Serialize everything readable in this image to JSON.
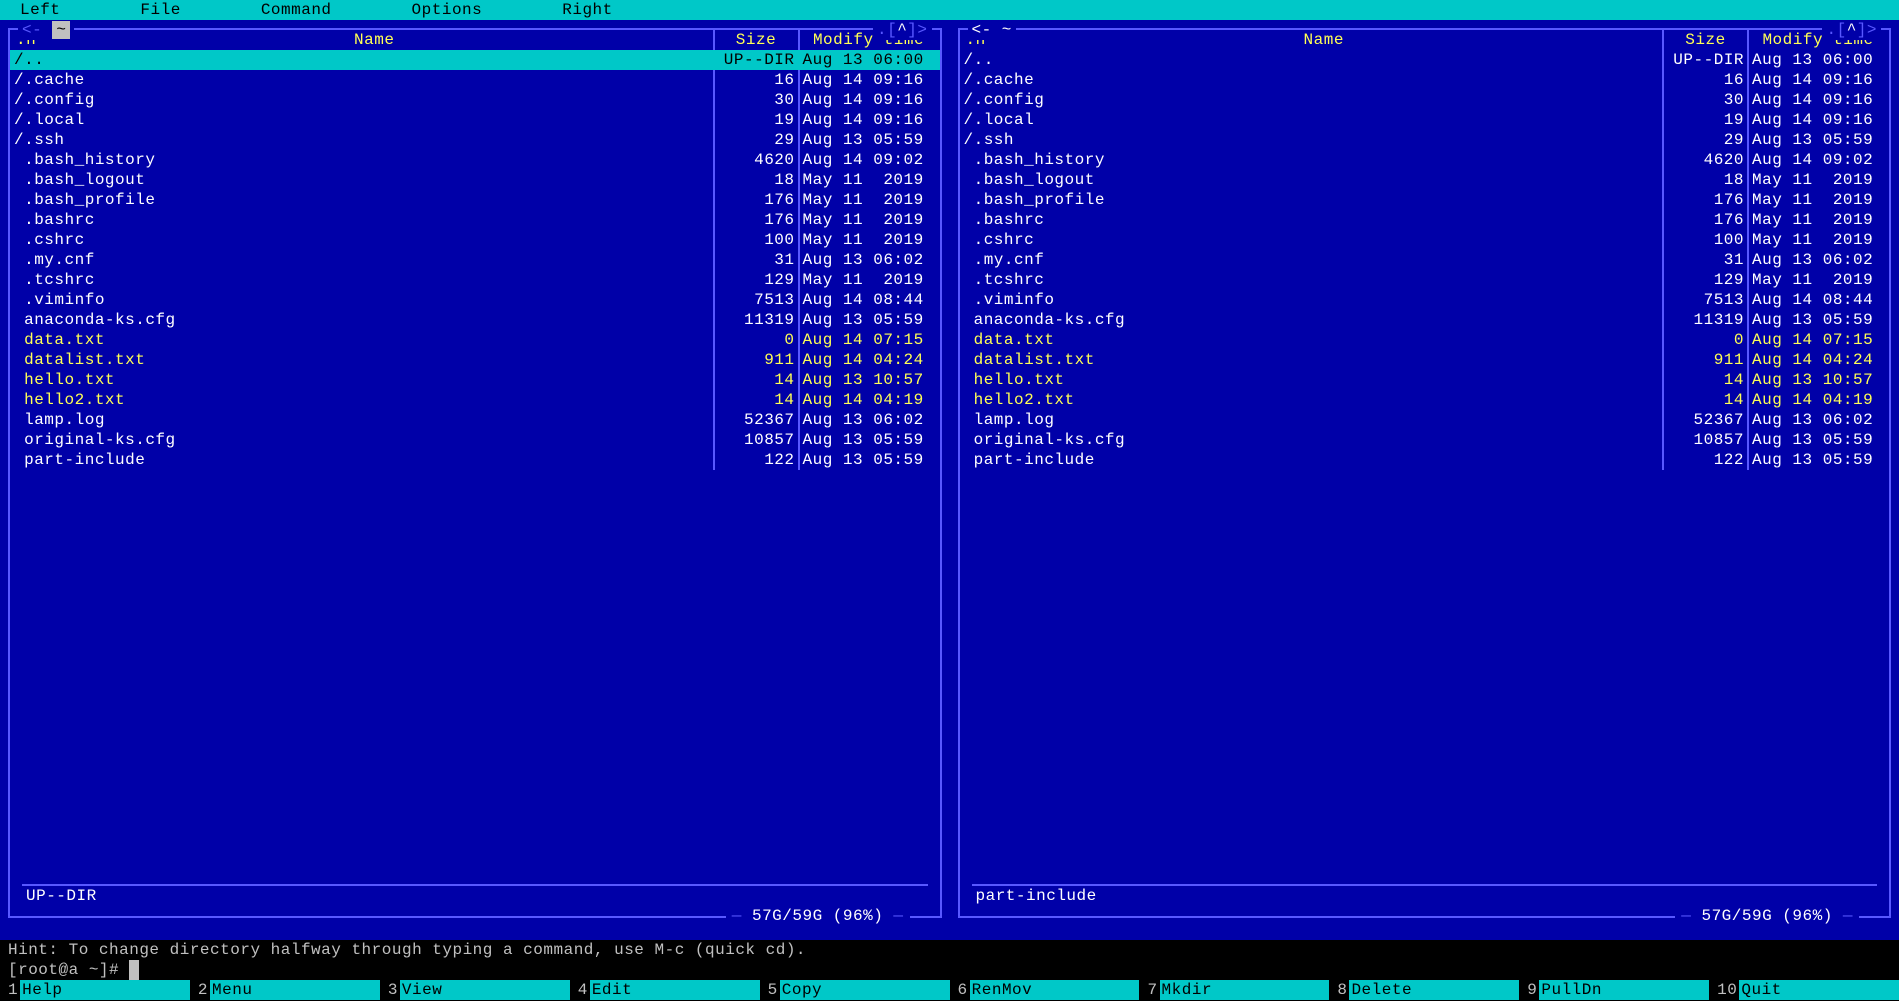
{
  "menubar": {
    "left": "Left",
    "file": "File",
    "command": "Command",
    "options": "Options",
    "right": "Right"
  },
  "panel_indicator": ".[^]>",
  "left_panel_prefix": "<- ",
  "right_panel_prefix": "<- ~ ",
  "cwd_symbol": "~",
  "headers": {
    "sort": ".n",
    "name": "Name",
    "size": "Size",
    "mtime": "Modify time"
  },
  "left_panel": {
    "selected_index": 0,
    "status": "UP--DIR",
    "disk": "57G/59G (96%)",
    "rows": [
      {
        "name": "/..",
        "size": "UP--DIR",
        "mtime": "Aug 13 06:00",
        "yellow": false
      },
      {
        "name": "/.cache",
        "size": "16",
        "mtime": "Aug 14 09:16",
        "yellow": false
      },
      {
        "name": "/.config",
        "size": "30",
        "mtime": "Aug 14 09:16",
        "yellow": false
      },
      {
        "name": "/.local",
        "size": "19",
        "mtime": "Aug 14 09:16",
        "yellow": false
      },
      {
        "name": "/.ssh",
        "size": "29",
        "mtime": "Aug 13 05:59",
        "yellow": false
      },
      {
        "name": " .bash_history",
        "size": "4620",
        "mtime": "Aug 14 09:02",
        "yellow": false
      },
      {
        "name": " .bash_logout",
        "size": "18",
        "mtime": "May 11  2019",
        "yellow": false
      },
      {
        "name": " .bash_profile",
        "size": "176",
        "mtime": "May 11  2019",
        "yellow": false
      },
      {
        "name": " .bashrc",
        "size": "176",
        "mtime": "May 11  2019",
        "yellow": false
      },
      {
        "name": " .cshrc",
        "size": "100",
        "mtime": "May 11  2019",
        "yellow": false
      },
      {
        "name": " .my.cnf",
        "size": "31",
        "mtime": "Aug 13 06:02",
        "yellow": false
      },
      {
        "name": " .tcshrc",
        "size": "129",
        "mtime": "May 11  2019",
        "yellow": false
      },
      {
        "name": " .viminfo",
        "size": "7513",
        "mtime": "Aug 14 08:44",
        "yellow": false
      },
      {
        "name": " anaconda-ks.cfg",
        "size": "11319",
        "mtime": "Aug 13 05:59",
        "yellow": false
      },
      {
        "name": " data.txt",
        "size": "0",
        "mtime": "Aug 14 07:15",
        "yellow": true
      },
      {
        "name": " datalist.txt",
        "size": "911",
        "mtime": "Aug 14 04:24",
        "yellow": true
      },
      {
        "name": " hello.txt",
        "size": "14",
        "mtime": "Aug 13 10:57",
        "yellow": true
      },
      {
        "name": " hello2.txt",
        "size": "14",
        "mtime": "Aug 14 04:19",
        "yellow": true
      },
      {
        "name": " lamp.log",
        "size": "52367",
        "mtime": "Aug 13 06:02",
        "yellow": false
      },
      {
        "name": " original-ks.cfg",
        "size": "10857",
        "mtime": "Aug 13 05:59",
        "yellow": false
      },
      {
        "name": " part-include",
        "size": "122",
        "mtime": "Aug 13 05:59",
        "yellow": false
      }
    ]
  },
  "right_panel": {
    "selected_index": -1,
    "status": "part-include",
    "disk": "57G/59G (96%)",
    "rows": [
      {
        "name": "/..",
        "size": "UP--DIR",
        "mtime": "Aug 13 06:00",
        "yellow": false
      },
      {
        "name": "/.cache",
        "size": "16",
        "mtime": "Aug 14 09:16",
        "yellow": false
      },
      {
        "name": "/.config",
        "size": "30",
        "mtime": "Aug 14 09:16",
        "yellow": false
      },
      {
        "name": "/.local",
        "size": "19",
        "mtime": "Aug 14 09:16",
        "yellow": false
      },
      {
        "name": "/.ssh",
        "size": "29",
        "mtime": "Aug 13 05:59",
        "yellow": false
      },
      {
        "name": " .bash_history",
        "size": "4620",
        "mtime": "Aug 14 09:02",
        "yellow": false
      },
      {
        "name": " .bash_logout",
        "size": "18",
        "mtime": "May 11  2019",
        "yellow": false
      },
      {
        "name": " .bash_profile",
        "size": "176",
        "mtime": "May 11  2019",
        "yellow": false
      },
      {
        "name": " .bashrc",
        "size": "176",
        "mtime": "May 11  2019",
        "yellow": false
      },
      {
        "name": " .cshrc",
        "size": "100",
        "mtime": "May 11  2019",
        "yellow": false
      },
      {
        "name": " .my.cnf",
        "size": "31",
        "mtime": "Aug 13 06:02",
        "yellow": false
      },
      {
        "name": " .tcshrc",
        "size": "129",
        "mtime": "May 11  2019",
        "yellow": false
      },
      {
        "name": " .viminfo",
        "size": "7513",
        "mtime": "Aug 14 08:44",
        "yellow": false
      },
      {
        "name": " anaconda-ks.cfg",
        "size": "11319",
        "mtime": "Aug 13 05:59",
        "yellow": false
      },
      {
        "name": " data.txt",
        "size": "0",
        "mtime": "Aug 14 07:15",
        "yellow": true
      },
      {
        "name": " datalist.txt",
        "size": "911",
        "mtime": "Aug 14 04:24",
        "yellow": true
      },
      {
        "name": " hello.txt",
        "size": "14",
        "mtime": "Aug 13 10:57",
        "yellow": true
      },
      {
        "name": " hello2.txt",
        "size": "14",
        "mtime": "Aug 14 04:19",
        "yellow": true
      },
      {
        "name": " lamp.log",
        "size": "52367",
        "mtime": "Aug 13 06:02",
        "yellow": false
      },
      {
        "name": " original-ks.cfg",
        "size": "10857",
        "mtime": "Aug 13 05:59",
        "yellow": false
      },
      {
        "name": " part-include",
        "size": "122",
        "mtime": "Aug 13 05:59",
        "yellow": false
      }
    ]
  },
  "hint": "Hint: To change directory halfway through typing a command, use M-c (quick cd).",
  "prompt": "[root@a ~]# ",
  "fkeys": [
    {
      "n": "1",
      "lbl": "Help"
    },
    {
      "n": "2",
      "lbl": "Menu"
    },
    {
      "n": "3",
      "lbl": "View"
    },
    {
      "n": "4",
      "lbl": "Edit"
    },
    {
      "n": "5",
      "lbl": "Copy"
    },
    {
      "n": "6",
      "lbl": "RenMov"
    },
    {
      "n": "7",
      "lbl": "Mkdir"
    },
    {
      "n": "8",
      "lbl": "Delete"
    },
    {
      "n": "9",
      "lbl": "PullDn"
    },
    {
      "n": "10",
      "lbl": "Quit"
    }
  ]
}
